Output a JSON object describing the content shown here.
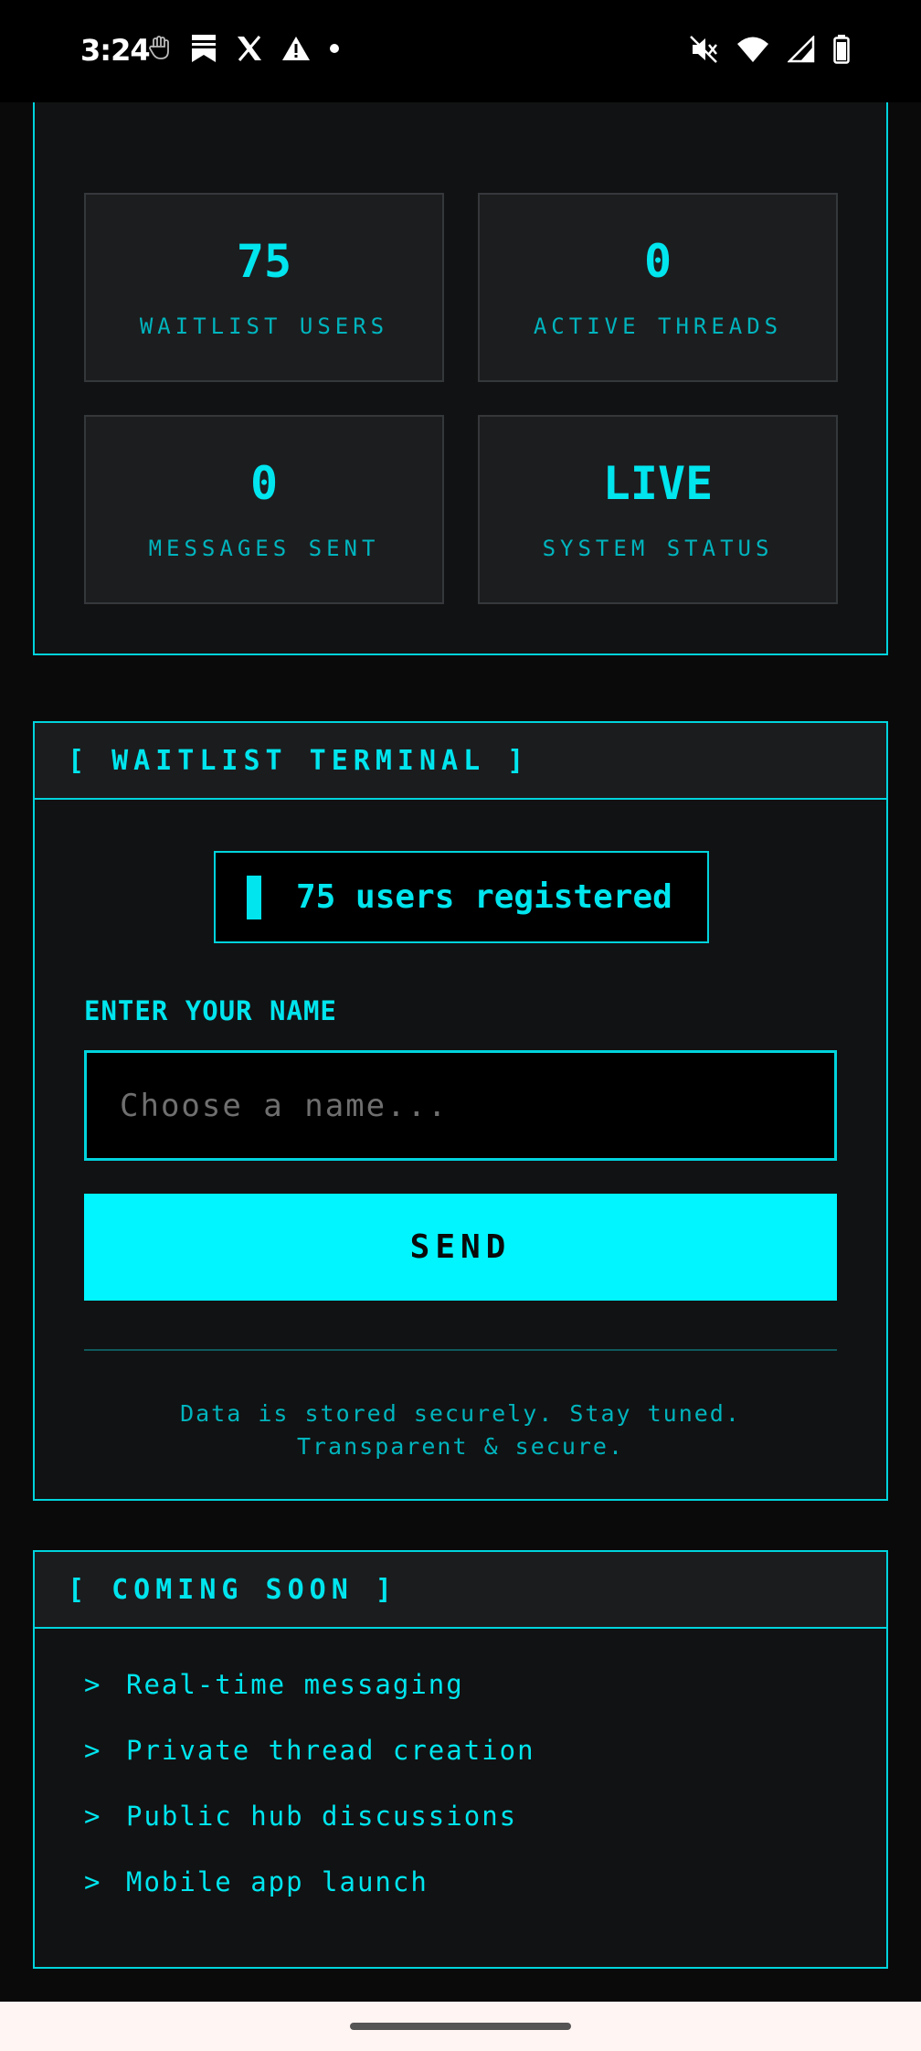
{
  "status_bar": {
    "time": "3:24",
    "left_icons": [
      "hand-icon",
      "bookmark-icon",
      "x-logo-icon",
      "warning-icon",
      "dot-icon"
    ],
    "right_icons": [
      "mute-icon",
      "wifi-icon",
      "signal-icon",
      "battery-icon"
    ]
  },
  "stats": [
    {
      "value": "75",
      "label": "WAITLIST USERS"
    },
    {
      "value": "0",
      "label": "ACTIVE THREADS"
    },
    {
      "value": "0",
      "label": "MESSAGES SENT"
    },
    {
      "value": "LIVE",
      "label": "SYSTEM STATUS"
    }
  ],
  "waitlist": {
    "title": "[ WAITLIST TERMINAL ]",
    "count_text": "75 users registered",
    "field_label": "ENTER YOUR NAME",
    "input_value": "",
    "input_placeholder": "Choose a name...",
    "send_label": "SEND",
    "note_line1": "Data is stored securely. Stay tuned.",
    "note_line2": "Transparent & secure."
  },
  "coming_soon": {
    "title": "[ COMING SOON ]",
    "items": [
      {
        "chevron": ">",
        "text": "Real-time messaging"
      },
      {
        "chevron": ">",
        "text": "Private thread creation"
      },
      {
        "chevron": ">",
        "text": "Public hub discussions"
      },
      {
        "chevron": ">",
        "text": "Mobile app launch"
      }
    ]
  },
  "colors": {
    "accent": "#00e5ee",
    "button": "#00f5ff",
    "background": "#0a0a0a",
    "card": "#111213"
  }
}
